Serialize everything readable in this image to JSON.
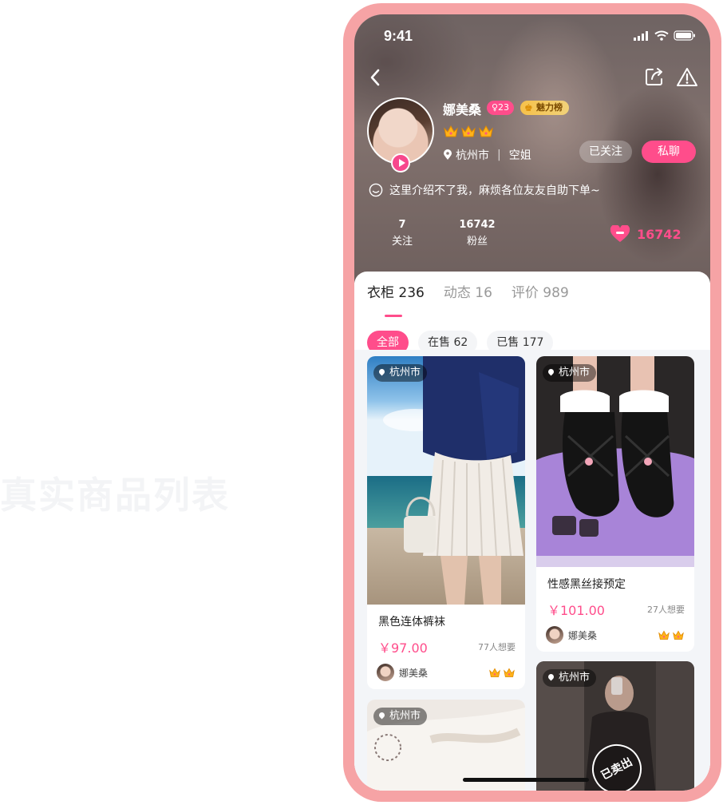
{
  "background_caption": "真实商品列表",
  "status_bar": {
    "time": "9:41"
  },
  "profile": {
    "name": "娜美桑",
    "gender_age": "♀23",
    "charm_badge": "魅力榜",
    "crown_count": 3,
    "city": "杭州市",
    "occupation": "空姐",
    "followed_label": "已关注",
    "chat_label": "私聊",
    "bio": "这里介绍不了我，麻烦各位友友自助下单~",
    "stats": [
      {
        "value": "7",
        "label": "关注"
      },
      {
        "value": "16742",
        "label": "粉丝"
      }
    ],
    "likes": "16742"
  },
  "tabs": [
    {
      "label": "衣柜 236",
      "active": true
    },
    {
      "label": "动态 16",
      "active": false
    },
    {
      "label": "评价 989",
      "active": false
    }
  ],
  "filters": [
    {
      "label": "全部",
      "active": true
    },
    {
      "label": "在售 62",
      "active": false
    },
    {
      "label": "已售 177",
      "active": false
    }
  ],
  "products": [
    {
      "city": "杭州市",
      "title": "黑色连体裤袜",
      "price": "￥97.00",
      "wants": "77人想要",
      "seller": "娜美桑",
      "crowns": 2
    },
    {
      "city": "杭州市",
      "title": "性感黑丝接预定",
      "price": "￥101.00",
      "wants": "27人想要",
      "seller": "娜美桑",
      "crowns": 2
    },
    {
      "city": "杭州市"
    },
    {
      "city": "杭州市",
      "sold_stamp": "已卖出"
    }
  ],
  "colors": {
    "accent": "#ff4d8b",
    "frame": "#f6a3a5"
  },
  "icons": [
    "back-arrow-icon",
    "share-icon",
    "warning-icon",
    "signal-icon",
    "wifi-icon",
    "battery-icon",
    "location-pin-icon",
    "smile-icon",
    "heart-icon",
    "crown-icon",
    "play-icon"
  ]
}
